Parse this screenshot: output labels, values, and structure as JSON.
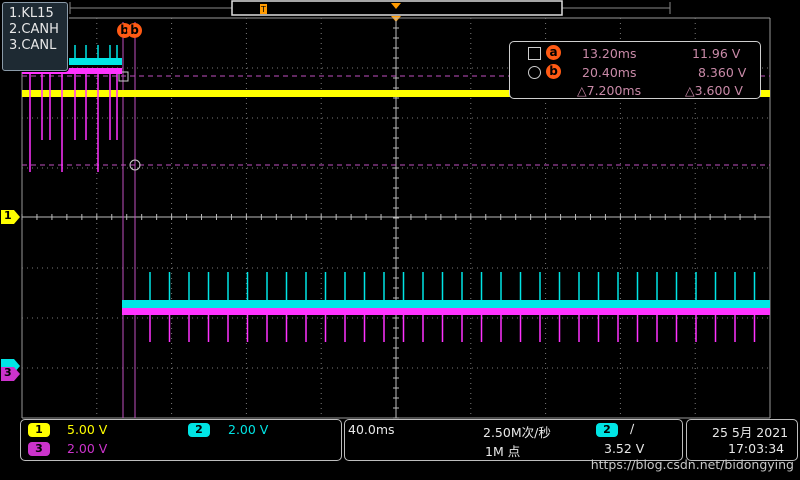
{
  "legend": {
    "items": [
      "1.KL15",
      "2.CANH",
      "3.CANL"
    ]
  },
  "cursor_markers": {
    "b_label": "b",
    "b_label2": "b"
  },
  "cursor_readout": {
    "a": {
      "label": "a",
      "time": "13.20ms",
      "volt": "11.96 V"
    },
    "b": {
      "label": "b",
      "time": "20.40ms",
      "volt": "8.360 V"
    },
    "delta": {
      "time": "△7.200ms",
      "volt": "△3.600 V"
    }
  },
  "channel_markers": {
    "ch1": "1",
    "ch3": "3"
  },
  "channels": [
    {
      "num": "1",
      "scale": "5.00 V",
      "color": "#ffff00"
    },
    {
      "num": "2",
      "scale": "2.00 V",
      "color": "#00e5e5"
    },
    {
      "num": "3",
      "scale": "2.00 V",
      "color": "#cc33cc"
    }
  ],
  "timebase": {
    "scale": "40.0ms",
    "sample_rate": "2.50M次/秒",
    "points": "1M 点"
  },
  "trigger": {
    "channel": "2",
    "slope": "∕",
    "level": "3.52 V"
  },
  "datetime": {
    "date": "25 5月 2021",
    "time": "17:03:34"
  },
  "watermark": "https://blog.csdn.net/bidongying",
  "trigger_marker": "T",
  "colors": {
    "ch1": "#ffff00",
    "ch2": "#00e5e5",
    "ch3": "#ff33ff",
    "grid": "#7a7a7a",
    "cursor": "#c050c0",
    "badge": "#ff5a14"
  }
}
